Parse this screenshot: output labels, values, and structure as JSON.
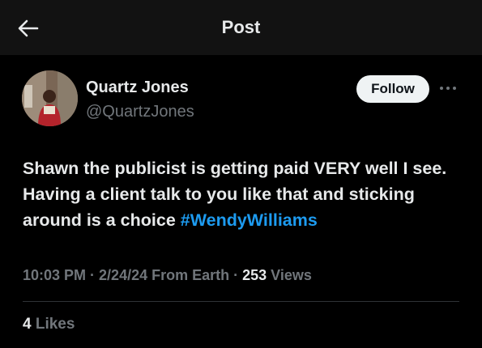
{
  "header": {
    "title": "Post",
    "back_icon": "arrow-left-icon"
  },
  "author": {
    "name": "Quartz Jones",
    "handle": "@QuartzJones",
    "avatar_icon": "profile-photo"
  },
  "actions": {
    "follow_label": "Follow",
    "more_icon": "more-horizontal-icon"
  },
  "post": {
    "text": "Shawn the publicist is getting paid VERY well I see. Having a client talk to you like that and sticking around is a choice ",
    "hashtag": "#WendyWilliams"
  },
  "meta": {
    "time": "10:03 PM",
    "separator": " · ",
    "date": "2/24/24",
    "source": " From Earth",
    "views_count": "253",
    "views_label": " Views"
  },
  "engagement": {
    "likes_count": "4",
    "likes_label": " Likes"
  },
  "colors": {
    "background": "#000000",
    "header_bg": "#121212",
    "text": "#e7e9ea",
    "muted": "#71767b",
    "link": "#1d9bf0",
    "button_bg": "#eff3f4"
  }
}
